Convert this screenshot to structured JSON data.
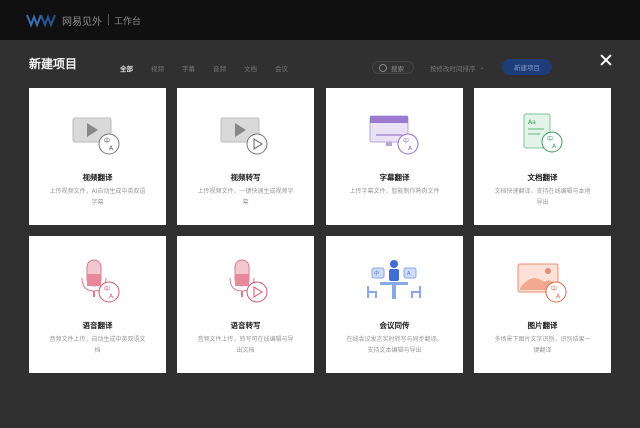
{
  "header": {
    "brand": "网易见外",
    "workspace": "工作台"
  },
  "modal": {
    "title": "新建项目",
    "tabs": [
      "全部",
      "视频",
      "字幕",
      "音频",
      "文档",
      "会议"
    ],
    "active_tab": "全部",
    "search_label": "搜索",
    "sort_label": "按修改时间排序",
    "new_label": "新建项目"
  },
  "cards": [
    {
      "title": "视频翻译",
      "desc": "上传视频文件，AI自动生成中英双语字幕",
      "icon": "video-translate-icon"
    },
    {
      "title": "视频转写",
      "desc": "上传视频文件，一键快速生成视频字幕",
      "icon": "video-transcribe-icon"
    },
    {
      "title": "字幕翻译",
      "desc": "上传字幕文件，智能制作熟肉文件",
      "icon": "subtitle-translate-icon"
    },
    {
      "title": "文档翻译",
      "desc": "文档快速翻译，支持在线编辑与本地导出",
      "icon": "document-translate-icon"
    },
    {
      "title": "语音翻译",
      "desc": "音频文件上传，自动生成中英双语文档",
      "icon": "audio-translate-icon"
    },
    {
      "title": "语音转写",
      "desc": "音频文件上传，转写可在线编辑与导出文档",
      "icon": "audio-transcribe-icon"
    },
    {
      "title": "会议同传",
      "desc": "在线会议发言实时转写与同步翻译，支持文本编辑与导出",
      "icon": "meeting-interpret-icon"
    },
    {
      "title": "图片翻译",
      "desc": "多场景下图片文字识别，识别结果一键翻译",
      "icon": "image-translate-icon"
    }
  ],
  "colors": {
    "card_bg": "#ffffff",
    "overlay_bg": "#303030",
    "topbar_bg": "#101010",
    "primary_button": "#1e3c78"
  }
}
